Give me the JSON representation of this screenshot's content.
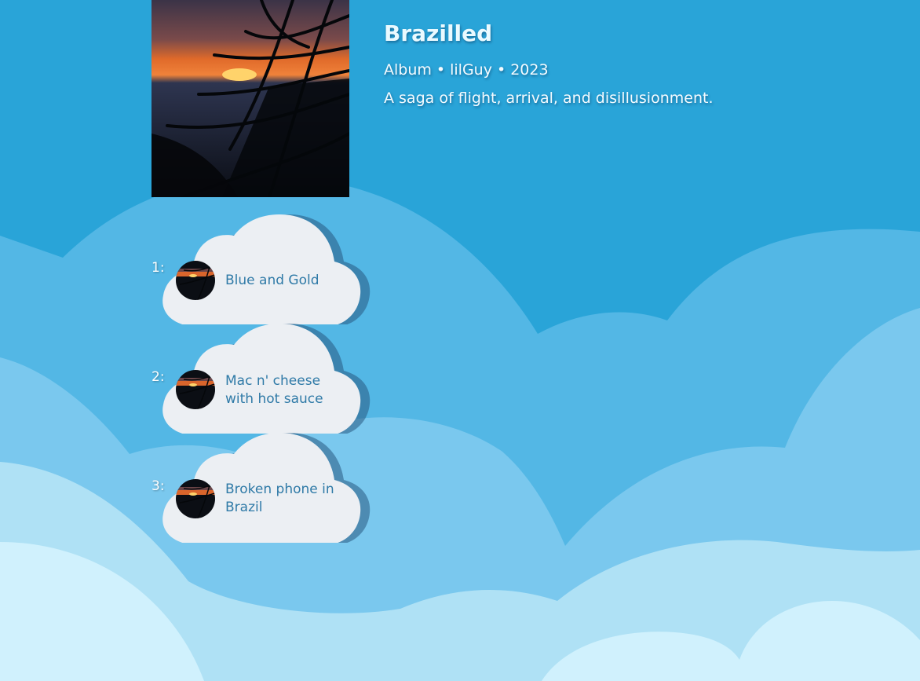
{
  "album": {
    "title": "Brazilled",
    "type": "Album",
    "separator": "•",
    "artist": "lilGuy",
    "year": "2023",
    "description": "A saga of flight, arrival, and disillusionment.",
    "art_icon": "sunset-palm-image"
  },
  "tracks": [
    {
      "number": "1:",
      "name": "Blue and Gold"
    },
    {
      "number": "2:",
      "name": "Mac n' cheese with hot sauce"
    },
    {
      "number": "3:",
      "name": "Broken phone in Brazil"
    }
  ],
  "colors": {
    "sky": "#29a4d8",
    "cloud_layer_1": "#53b7e5",
    "cloud_layer_2": "#7ac8ee",
    "cloud_layer_3": "#afe1f5",
    "cloud_layer_4": "#d0f1fd",
    "track_cloud": "#eceff3",
    "track_text": "#2f7aa7"
  }
}
